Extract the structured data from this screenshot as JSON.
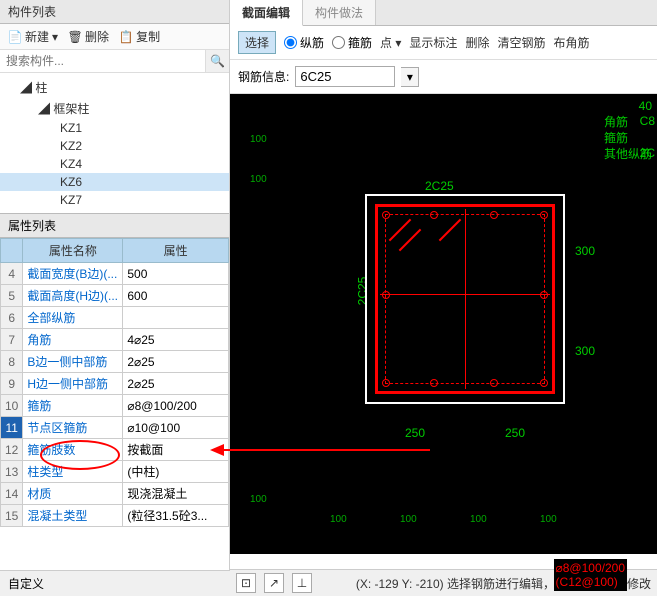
{
  "left": {
    "comp_list_hdr": "构件列表",
    "toolbar": {
      "new": "新建",
      "del": "删除",
      "copy": "复制"
    },
    "search_ph": "搜索构件...",
    "tree": {
      "root": "柱",
      "sub": "框架柱",
      "items": [
        "KZ1",
        "KZ2",
        "KZ4",
        "KZ6",
        "KZ7"
      ],
      "sel": "KZ6"
    },
    "prop_hdr": "属性列表",
    "cols": {
      "name": "属性名称",
      "val": "属性"
    },
    "rows": [
      {
        "n": "4",
        "k": "截面宽度(B边)(...",
        "v": "500"
      },
      {
        "n": "5",
        "k": "截面高度(H边)(...",
        "v": "600"
      },
      {
        "n": "6",
        "k": "全部纵筋",
        "v": ""
      },
      {
        "n": "7",
        "k": "角筋",
        "v": "4⌀25"
      },
      {
        "n": "8",
        "k": "B边一侧中部筋",
        "v": "2⌀25"
      },
      {
        "n": "9",
        "k": "H边一侧中部筋",
        "v": "2⌀25"
      },
      {
        "n": "10",
        "k": "箍筋",
        "v": "⌀8@100/200"
      },
      {
        "n": "11",
        "k": "节点区箍筋",
        "v": "⌀10@100",
        "hl": true
      },
      {
        "n": "12",
        "k": "箍筋肢数",
        "v": "按截面"
      },
      {
        "n": "13",
        "k": "柱类型",
        "v": "(中柱)"
      },
      {
        "n": "14",
        "k": "材质",
        "v": "现浇混凝土"
      },
      {
        "n": "15",
        "k": "混凝土类型",
        "v": "(粒径31.5砼3..."
      }
    ],
    "custom": "自定义"
  },
  "right": {
    "tabs": [
      "截面编辑",
      "构件做法"
    ],
    "active": 0,
    "tb": {
      "select": "选择",
      "zong": "纵筋",
      "gu": "箍筋",
      "dian": "点",
      "biao": "显示标注",
      "del": "删除",
      "clear": "清空钢筋",
      "bujiao": "布角筋"
    },
    "info_lbl": "钢筋信息:",
    "info_val": "6C25",
    "legend": [
      "角筋",
      "箍筋",
      "其他纵筋"
    ],
    "dims": {
      "top": "2C25",
      "left": "2C25",
      "r300a": "300",
      "r300b": "300",
      "b250a": "250",
      "b250b": "250",
      "r40": "40",
      "rC8": "C8",
      "r2C": "2C"
    },
    "ticks": "100",
    "status": "(X: -129 Y: -210)  选择钢筋进行编辑，选择标注进行修改",
    "bottom_red": "⌀8@100/200",
    "bottom_red2": "(C12@100)"
  }
}
